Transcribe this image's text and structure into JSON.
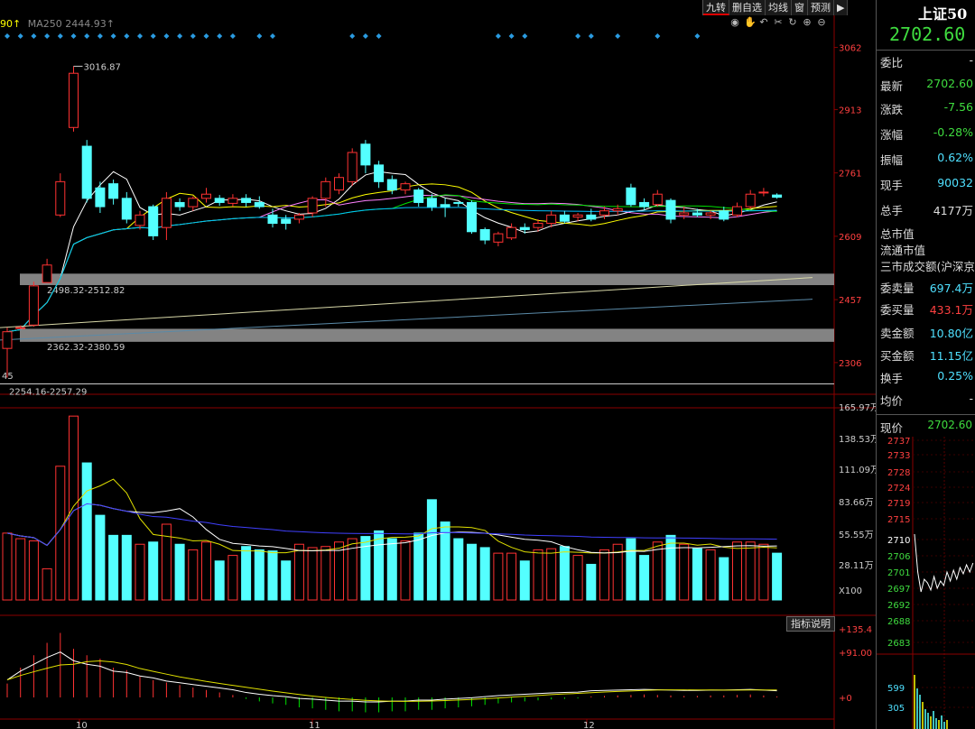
{
  "legend": {
    "ma_prefix": "90↑",
    "ma250_label": "MA250",
    "ma250_value": "2444.93↑"
  },
  "toolbar": [
    "九转",
    "删自选",
    "均线",
    "窗",
    "预测",
    "▶"
  ],
  "tool_icons": [
    "eye-icon",
    "hand-icon",
    "undo-icon",
    "scissors-icon",
    "refresh-icon",
    "zoom-in-icon",
    "zoom-out-icon"
  ],
  "price_axis": [
    "3062",
    "2913",
    "2761",
    "2609",
    "2457",
    "2306"
  ],
  "volume_axis": [
    "165.97万",
    "138.53万",
    "111.09万",
    "83.66万",
    "55.55万",
    "28.11万",
    "X100"
  ],
  "macd_axis": [
    "+135.4",
    "+91.00",
    "+0"
  ],
  "indicator_button": "指标说明",
  "annotations": {
    "high": "3016.87",
    "gap1": "2498.32-2512.82",
    "gap2": "2362.32-2380.59",
    "gap3": "2254.16-2257.29",
    "left_low": "45"
  },
  "date_labels": [
    "10",
    "11",
    "12"
  ],
  "quote": {
    "name": "上证50",
    "price": "2702.60",
    "rows": [
      {
        "label": "委比",
        "value": "-",
        "color": "#dddddd"
      },
      {
        "label": "最新",
        "value": "2702.60",
        "color": "#3fdc3f"
      },
      {
        "label": "涨跌",
        "value": "-7.56",
        "color": "#3fdc3f"
      },
      {
        "label": "涨幅",
        "value": "-0.28%",
        "color": "#3fdc3f"
      },
      {
        "label": "振幅",
        "value": "0.62%",
        "color": "#4fe0ff"
      },
      {
        "label": "现手",
        "value": "90032",
        "color": "#4fe0ff"
      },
      {
        "label": "总手",
        "value": "4177万",
        "color": "#dddddd"
      },
      {
        "label": "总市值",
        "value": "",
        "color": "#dddddd"
      },
      {
        "label": "流通市值",
        "value": "",
        "color": "#dddddd"
      },
      {
        "label": "三市成交额(沪深京)",
        "value": "",
        "color": "#dddddd"
      },
      {
        "label": "委卖量",
        "value": "697.4万",
        "color": "#4fe0ff"
      },
      {
        "label": "委买量",
        "value": "433.1万",
        "color": "#ff4040"
      },
      {
        "label": "卖金额",
        "value": "10.80亿",
        "color": "#4fe0ff"
      },
      {
        "label": "买金额",
        "value": "11.15亿",
        "color": "#4fe0ff"
      },
      {
        "label": "换手",
        "value": "0.25%",
        "color": "#4fe0ff"
      },
      {
        "label": "均价",
        "value": "-",
        "color": "#dddddd"
      }
    ],
    "current_label": "现价",
    "current_value": "2702.60"
  },
  "mini_axis": [
    "2737",
    "2733",
    "2728",
    "2724",
    "2719",
    "2715",
    "2710",
    "2706",
    "2701",
    "2697",
    "2692",
    "2688",
    "2683",
    "599",
    "305"
  ],
  "colors": {
    "up": "#ff3232",
    "down": "#54ffff",
    "ma5": "#ffffff",
    "ma10": "#ffff00",
    "ma20": "#ff80ff",
    "ma30": "#00e000",
    "ma60": "#00c0ff"
  },
  "chart_data": {
    "type": "candlestick",
    "ylim": [
      2230,
      3100
    ],
    "candles": [
      {
        "o": 2340,
        "c": 2380,
        "h": 2390,
        "l": 2270,
        "v": 60
      },
      {
        "o": 2390,
        "c": 2390,
        "h": 2395,
        "l": 2385,
        "v": 55
      },
      {
        "o": 2396,
        "c": 2490,
        "h": 2500,
        "l": 2392,
        "v": 53
      },
      {
        "o": 2498,
        "c": 2540,
        "h": 2555,
        "l": 2498,
        "v": 28
      },
      {
        "o": 2660,
        "c": 2740,
        "h": 2760,
        "l": 2655,
        "v": 120
      },
      {
        "o": 2870,
        "c": 3000,
        "h": 3016.87,
        "l": 2860,
        "v": 165
      },
      {
        "o": 2825,
        "c": 2700,
        "h": 2840,
        "l": 2690,
        "v": 123
      },
      {
        "o": 2725,
        "c": 2680,
        "h": 2740,
        "l": 2665,
        "v": 76
      },
      {
        "o": 2735,
        "c": 2700,
        "h": 2745,
        "l": 2685,
        "v": 58
      },
      {
        "o": 2700,
        "c": 2650,
        "h": 2715,
        "l": 2640,
        "v": 58
      },
      {
        "o": 2635,
        "c": 2660,
        "h": 2670,
        "l": 2625,
        "v": 50
      },
      {
        "o": 2680,
        "c": 2610,
        "h": 2685,
        "l": 2600,
        "v": 52
      },
      {
        "o": 2630,
        "c": 2700,
        "h": 2715,
        "l": 2600,
        "v": 68
      },
      {
        "o": 2690,
        "c": 2680,
        "h": 2700,
        "l": 2670,
        "v": 50
      },
      {
        "o": 2680,
        "c": 2700,
        "h": 2705,
        "l": 2670,
        "v": 45
      },
      {
        "o": 2700,
        "c": 2710,
        "h": 2725,
        "l": 2690,
        "v": 52
      },
      {
        "o": 2700,
        "c": 2690,
        "h": 2708,
        "l": 2682,
        "v": 35
      },
      {
        "o": 2688,
        "c": 2700,
        "h": 2710,
        "l": 2680,
        "v": 40
      },
      {
        "o": 2700,
        "c": 2690,
        "h": 2710,
        "l": 2680,
        "v": 48
      },
      {
        "o": 2690,
        "c": 2680,
        "h": 2705,
        "l": 2675,
        "v": 45
      },
      {
        "o": 2660,
        "c": 2640,
        "h": 2675,
        "l": 2630,
        "v": 44
      },
      {
        "o": 2650,
        "c": 2640,
        "h": 2660,
        "l": 2625,
        "v": 35
      },
      {
        "o": 2650,
        "c": 2660,
        "h": 2665,
        "l": 2640,
        "v": 50
      },
      {
        "o": 2665,
        "c": 2700,
        "h": 2705,
        "l": 2655,
        "v": 47
      },
      {
        "o": 2700,
        "c": 2740,
        "h": 2750,
        "l": 2680,
        "v": 48
      },
      {
        "o": 2720,
        "c": 2750,
        "h": 2760,
        "l": 2710,
        "v": 52
      },
      {
        "o": 2740,
        "c": 2810,
        "h": 2820,
        "l": 2730,
        "v": 55
      },
      {
        "o": 2830,
        "c": 2780,
        "h": 2840,
        "l": 2760,
        "v": 57
      },
      {
        "o": 2780,
        "c": 2740,
        "h": 2790,
        "l": 2725,
        "v": 62
      },
      {
        "o": 2745,
        "c": 2720,
        "h": 2755,
        "l": 2710,
        "v": 55
      },
      {
        "o": 2720,
        "c": 2735,
        "h": 2740,
        "l": 2710,
        "v": 53
      },
      {
        "o": 2720,
        "c": 2690,
        "h": 2725,
        "l": 2680,
        "v": 60
      },
      {
        "o": 2700,
        "c": 2680,
        "h": 2710,
        "l": 2670,
        "v": 90
      },
      {
        "o": 2685,
        "c": 2680,
        "h": 2700,
        "l": 2655,
        "v": 70
      },
      {
        "o": 2690,
        "c": 2688,
        "h": 2692,
        "l": 2680,
        "v": 55
      },
      {
        "o": 2690,
        "c": 2620,
        "h": 2695,
        "l": 2615,
        "v": 50
      },
      {
        "o": 2625,
        "c": 2600,
        "h": 2630,
        "l": 2590,
        "v": 47
      },
      {
        "o": 2595,
        "c": 2615,
        "h": 2620,
        "l": 2585,
        "v": 42
      },
      {
        "o": 2605,
        "c": 2630,
        "h": 2640,
        "l": 2600,
        "v": 42
      },
      {
        "o": 2630,
        "c": 2625,
        "h": 2640,
        "l": 2615,
        "v": 35
      },
      {
        "o": 2630,
        "c": 2640,
        "h": 2650,
        "l": 2620,
        "v": 45
      },
      {
        "o": 2640,
        "c": 2660,
        "h": 2670,
        "l": 2630,
        "v": 46
      },
      {
        "o": 2660,
        "c": 2645,
        "h": 2670,
        "l": 2640,
        "v": 48
      },
      {
        "o": 2655,
        "c": 2660,
        "h": 2665,
        "l": 2645,
        "v": 40
      },
      {
        "o": 2660,
        "c": 2650,
        "h": 2675,
        "l": 2645,
        "v": 32
      },
      {
        "o": 2660,
        "c": 2670,
        "h": 2680,
        "l": 2650,
        "v": 45
      },
      {
        "o": 2670,
        "c": 2675,
        "h": 2685,
        "l": 2660,
        "v": 50
      },
      {
        "o": 2725,
        "c": 2685,
        "h": 2735,
        "l": 2680,
        "v": 55
      },
      {
        "o": 2690,
        "c": 2680,
        "h": 2700,
        "l": 2672,
        "v": 40
      },
      {
        "o": 2685,
        "c": 2710,
        "h": 2720,
        "l": 2680,
        "v": 52
      },
      {
        "o": 2695,
        "c": 2650,
        "h": 2700,
        "l": 2640,
        "v": 58
      },
      {
        "o": 2660,
        "c": 2665,
        "h": 2680,
        "l": 2650,
        "v": 50
      },
      {
        "o": 2665,
        "c": 2660,
        "h": 2675,
        "l": 2655,
        "v": 46
      },
      {
        "o": 2660,
        "c": 2665,
        "h": 2670,
        "l": 2650,
        "v": 45
      },
      {
        "o": 2670,
        "c": 2650,
        "h": 2680,
        "l": 2645,
        "v": 38
      },
      {
        "o": 2660,
        "c": 2680,
        "h": 2690,
        "l": 2655,
        "v": 52
      },
      {
        "o": 2680,
        "c": 2710,
        "h": 2720,
        "l": 2675,
        "v": 52
      },
      {
        "o": 2715,
        "c": 2715,
        "h": 2725,
        "l": 2705,
        "v": 50
      },
      {
        "o": 2708,
        "c": 2702.6,
        "h": 2712,
        "l": 2699,
        "v": 42
      }
    ],
    "macd_bars": [
      28,
      60,
      85,
      110,
      130,
      98,
      85,
      78,
      60,
      55,
      42,
      35,
      30,
      25,
      20,
      15,
      10,
      5,
      -3,
      -8,
      -12,
      -15,
      -20,
      -22,
      -25,
      -28,
      -28,
      -30,
      -30,
      -28,
      -28,
      -25,
      -25,
      -22,
      -20,
      -18,
      -15,
      -12,
      -10,
      -8,
      -6,
      -4,
      -3,
      -2,
      2,
      3,
      4,
      5,
      6,
      5,
      4,
      3,
      3,
      4,
      4,
      5,
      6,
      4,
      2
    ]
  }
}
